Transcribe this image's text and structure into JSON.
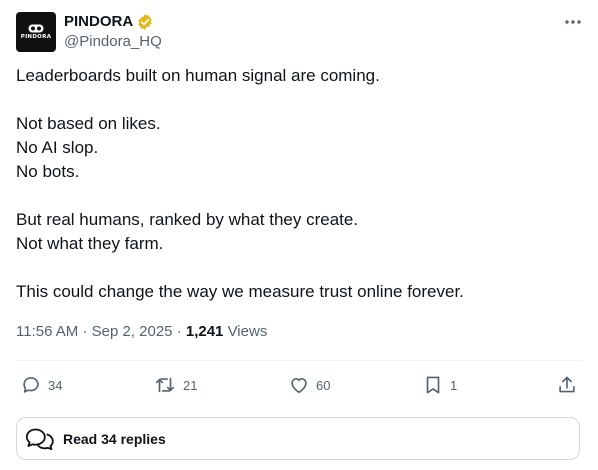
{
  "author": {
    "display_name": "PINDORA",
    "handle": "@Pindora_HQ",
    "avatar_text": "PINDORA",
    "verified_badge_color": "#e2b719",
    "avatar_bg": "#111111"
  },
  "post": {
    "lines": [
      "Leaderboards built on human signal are coming.",
      "",
      "Not based on likes.",
      "No AI slop.",
      "No bots.",
      "",
      "But real humans, ranked by what they create.",
      "Not what they farm.",
      "",
      "This could change the way we measure trust online forever."
    ],
    "time": "11:56 AM",
    "date": "Sep 2, 2025",
    "views_count": "1,241",
    "views_label": "Views"
  },
  "actions": {
    "replies": "34",
    "reposts": "21",
    "likes": "60",
    "bookmarks": "1"
  },
  "read_replies_label": "Read 34 replies",
  "icons": [
    "verified-badge-icon",
    "more-icon",
    "reply-icon",
    "repost-icon",
    "like-icon",
    "bookmark-icon",
    "share-icon",
    "replies-bubbles-icon"
  ],
  "colors": {
    "text": "#0f1419",
    "muted": "#536471",
    "border": "#cfd9de",
    "divider": "#eff3f4"
  }
}
